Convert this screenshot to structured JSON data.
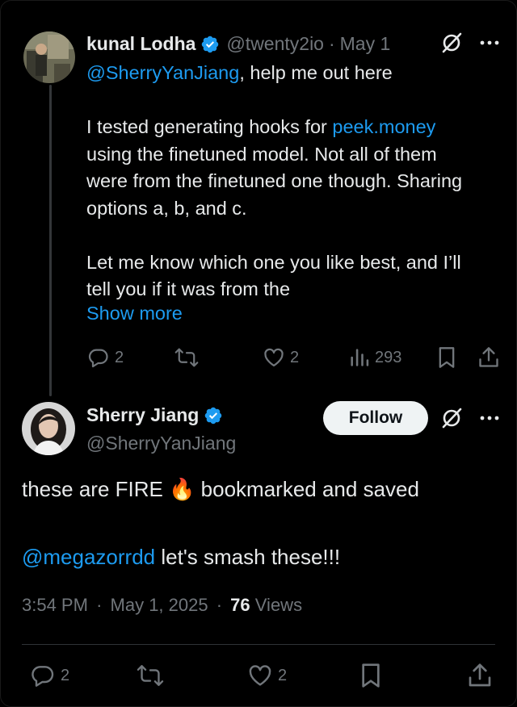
{
  "parent_tweet": {
    "display_name": "kunal Lodha",
    "handle": "@twenty2io",
    "separator": "·",
    "date": "May 1",
    "mention": "@SherryYanJiang",
    "line1_rest": ", help me out here",
    "para2_prefix": "I tested generating hooks for ",
    "para2_link": "peek.money",
    "para2_line2": "using the finetuned model. Not all of them",
    "para2_line3": "were from the finetuned one though. Sharing",
    "para2_line4": "options a, b, and c.",
    "para3_line1": "Let me know which one you like best, and I’ll",
    "para3_line2": "tell you if it was from the",
    "show_more": "Show more",
    "replies": "2",
    "likes": "2",
    "views": "293"
  },
  "reply_tweet": {
    "display_name": "Sherry Jiang",
    "handle": "@SherryYanJiang",
    "follow_label": "Follow",
    "text_before_emoji": "these are FIRE ",
    "emoji": "🔥",
    "text_after_emoji": " bookmarked and saved",
    "mention": "@megazorrdd",
    "mention_rest": " let's smash these!!!",
    "time": "3:54 PM",
    "meta_separator": "·",
    "full_date": "May 1, 2025",
    "views_count": "76",
    "views_label": "Views",
    "replies": "2",
    "likes": "2"
  },
  "colors": {
    "background": "#000000",
    "text": "#e7e9ea",
    "muted": "#71767b",
    "link": "#1d9bf0",
    "verified": "#1d9bf0"
  },
  "icons": [
    "grok-icon",
    "more-icon",
    "reply-icon",
    "retweet-icon",
    "like-icon",
    "views-icon",
    "bookmark-icon",
    "share-icon",
    "verified-icon"
  ]
}
